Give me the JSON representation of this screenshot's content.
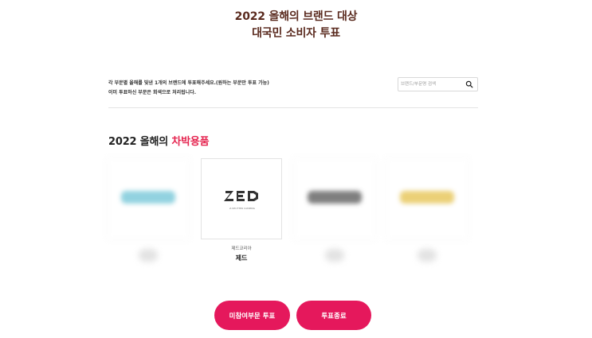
{
  "page": {
    "title_line1": "2022 올해의 브랜드 대상",
    "title_line2": "대국민 소비자 투표"
  },
  "notice": {
    "line1": "각 부문별 올해를 빛낸 1개의 브랜드에 투표해주세요.(원하는 부문만 투표 가능)",
    "line2": "이미 투표하신 부문은 회색으로 처리됩니다."
  },
  "search": {
    "placeholder": "브랜드/부문명 검색",
    "icon": "search-icon"
  },
  "category": {
    "prefix": "2022 올해의",
    "name": "차박용품"
  },
  "brands": [
    {
      "state": "blurred",
      "logo_color": "#6ec4d6",
      "company": "",
      "name": ""
    },
    {
      "state": "active",
      "logo": "ZED",
      "logo_sub": "Z-SHUTTER CAMPING",
      "company": "제드코리아",
      "name": "제드"
    },
    {
      "state": "blurred",
      "logo_color": "#555555",
      "company": "",
      "name": ""
    },
    {
      "state": "blurred",
      "logo_color": "#e5c14a",
      "company": "",
      "name": ""
    }
  ],
  "actions": {
    "partial_vote": "미참여부문 투표",
    "finish_vote": "투표종료"
  },
  "colors": {
    "accent": "#e5185c",
    "title": "#5a2a1e",
    "category_accent": "#e5244f"
  }
}
